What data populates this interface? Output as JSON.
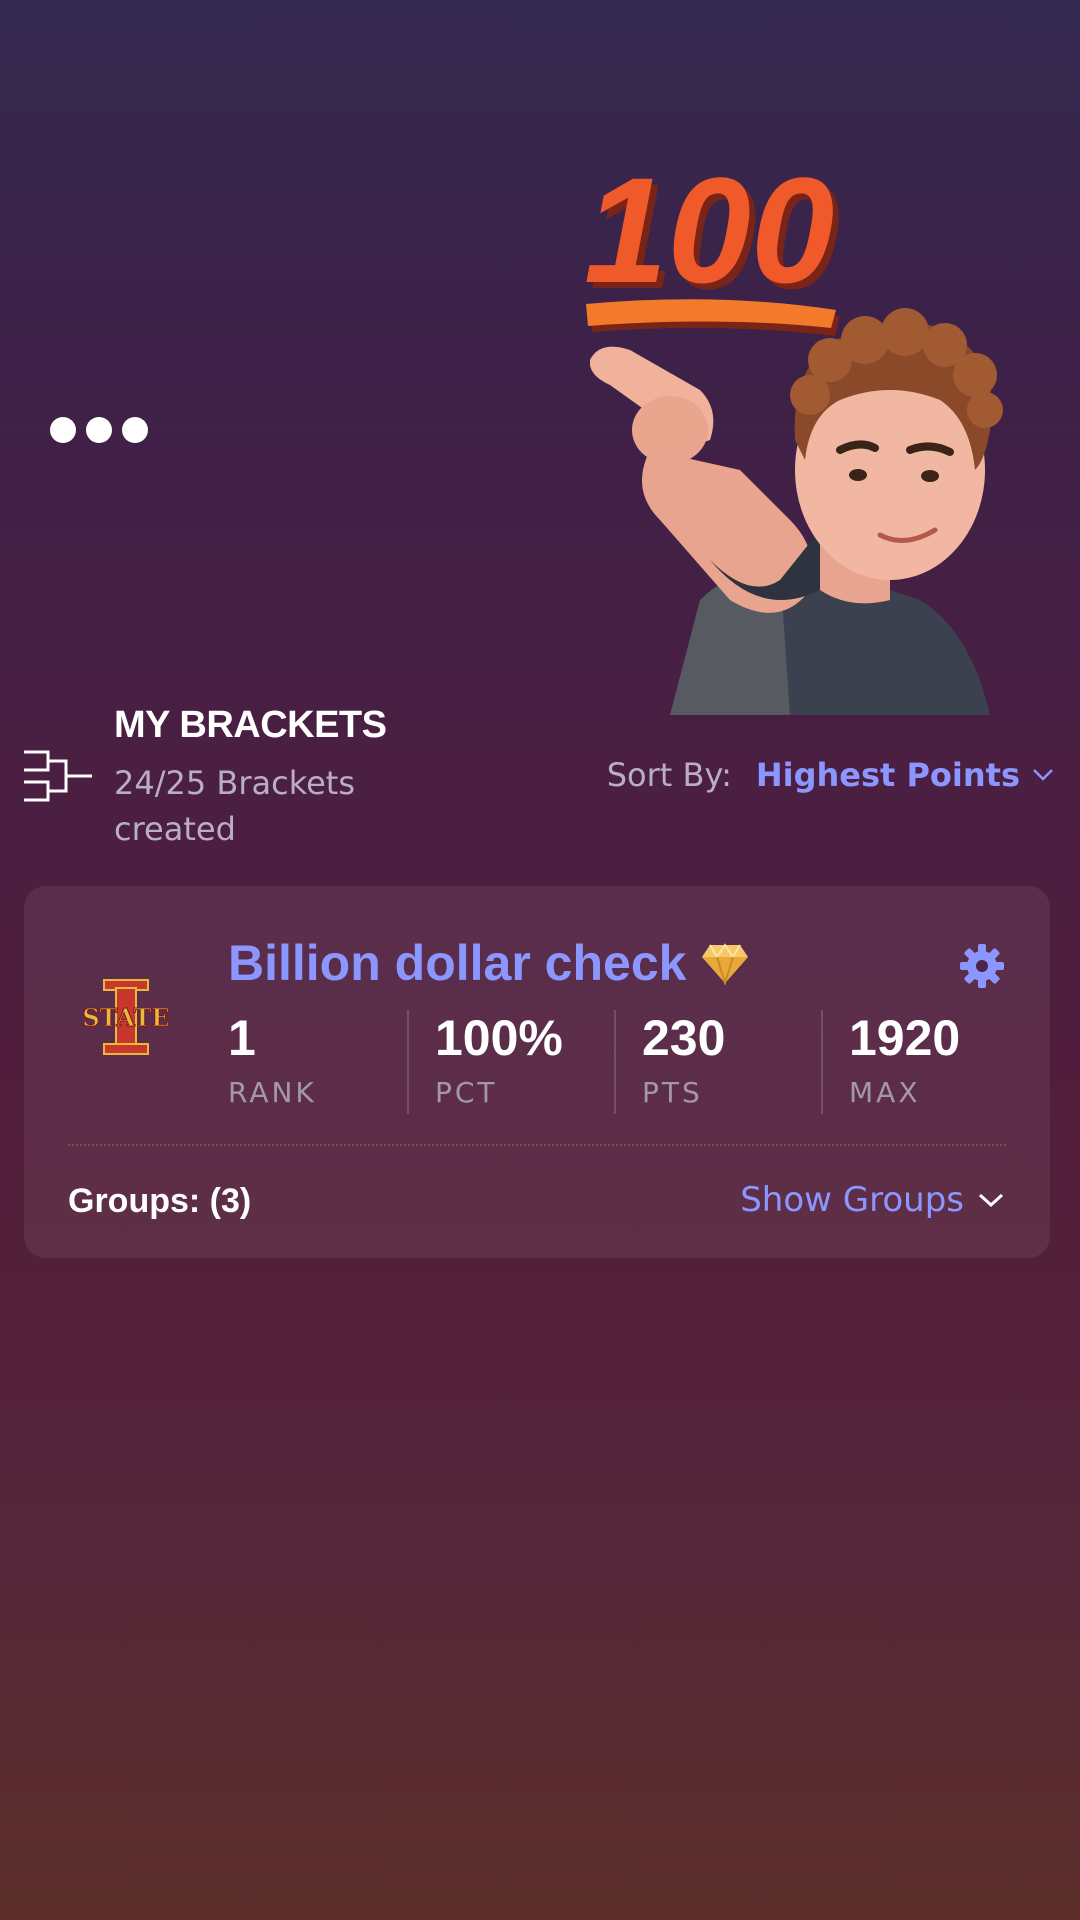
{
  "header": {
    "more_icon": "more-dots-icon"
  },
  "hero": {
    "emoji": "hundred-points",
    "avatar": "pointing-avatar"
  },
  "brackets": {
    "title": "MY BRACKETS",
    "subtitle": "24/25 Brackets created",
    "icon": "bracket-icon",
    "sort_label": "Sort By:",
    "sort_value": "Highest Points"
  },
  "card": {
    "name": "Billion dollar check",
    "team": "Iowa State",
    "stats": [
      {
        "value": "1",
        "label": "RANK"
      },
      {
        "value": "100%",
        "label": "PCT"
      },
      {
        "value": "230",
        "label": "PTS"
      },
      {
        "value": "1920",
        "label": "MAX"
      }
    ],
    "groups_label": "Groups: (3)",
    "show_groups": "Show Groups"
  },
  "colors": {
    "accent": "#8c96ff",
    "muted": "#b9aec4",
    "gold": "#e8b93a",
    "cardinal": "#b5283a"
  }
}
